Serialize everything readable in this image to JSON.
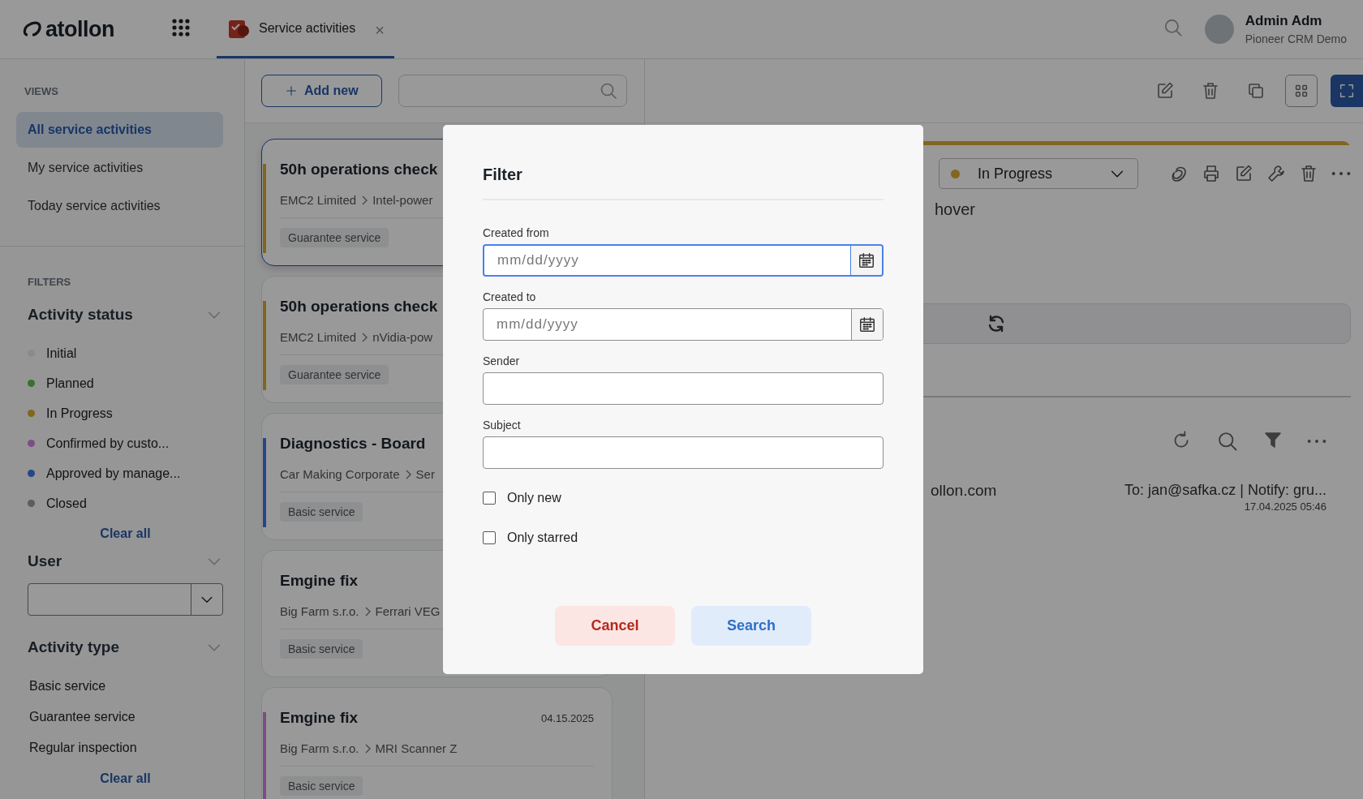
{
  "header": {
    "logo": "atollon",
    "tab": {
      "label": "Service activities",
      "close": "×"
    },
    "user": {
      "name": "Admin Adm",
      "org": "Pioneer CRM Demo"
    }
  },
  "sidebar": {
    "views_title": "VIEWS",
    "views": [
      {
        "label": "All service activities",
        "selected": true
      },
      {
        "label": "My service activities",
        "selected": false
      },
      {
        "label": "Today service activities",
        "selected": false
      }
    ],
    "filters_title": "FILTERS",
    "status_filter": {
      "title": "Activity status",
      "clear": "Clear all",
      "items": [
        {
          "label": "Initial",
          "color": "#8b8b8b"
        },
        {
          "label": "Planned",
          "color": "#37732c"
        },
        {
          "label": "In Progress",
          "color": "#82661f"
        },
        {
          "label": "Confirmed by custo...",
          "color": "#7d4c86"
        },
        {
          "label": "Approved by manage...",
          "color": "#244886"
        },
        {
          "label": "Closed",
          "color": "#5c5c5c"
        }
      ]
    },
    "user_filter": {
      "title": "User"
    },
    "type_filter": {
      "title": "Activity type",
      "clear": "Clear all",
      "items": [
        "Basic service",
        "Guarantee service",
        "Regular inspection"
      ]
    }
  },
  "list": {
    "add_button": "Add new",
    "cards": [
      {
        "title": "50h operations check",
        "customer": "EMC2 Limited",
        "asset": "Intel-power",
        "tag": "Guarantee service",
        "color": "#82661f",
        "selected": true
      },
      {
        "title": "50h operations check",
        "customer": "EMC2 Limited",
        "asset": "nVidia-pow",
        "tag": "Guarantee service",
        "color": "#82661f",
        "selected": false
      },
      {
        "title": "Diagnostics - Board",
        "customer": "Car Making Corporate",
        "asset": "Ser",
        "tag": "Basic service",
        "color": "#244886",
        "selected": false
      },
      {
        "title": "Emgine fix",
        "customer": "Big Farm s.r.o.",
        "asset": "Ferrari VEG",
        "tag": "Basic service",
        "selected": false
      },
      {
        "title": "Emgine fix",
        "customer": "Big Farm s.r.o.",
        "asset": "MRI Scanner Z",
        "tag": "Basic service",
        "color": "#7d4c86",
        "selected": false,
        "date": "04.15.2025"
      }
    ]
  },
  "detail": {
    "status": {
      "label": "In Progress",
      "color": "#82661f"
    },
    "text": "hover",
    "email": {
      "from": "ollon.com",
      "to": "To: jan@safka.cz | Notify: gru...",
      "time": "17.04.2025 05:46"
    }
  },
  "dialog": {
    "title": "Filter",
    "fields": [
      {
        "kind": "date",
        "label": "Created from",
        "placeholder": "mm/dd/yyyy",
        "focused": true
      },
      {
        "kind": "date",
        "label": "Created to",
        "placeholder": "mm/dd/yyyy",
        "focused": false
      },
      {
        "kind": "text",
        "label": "Sender",
        "focused": false
      },
      {
        "kind": "text",
        "label": "Subject",
        "focused": false
      }
    ],
    "checkboxes": [
      {
        "label": "Only new",
        "checked": false
      },
      {
        "label": "Only starred",
        "checked": false
      }
    ],
    "buttons": [
      {
        "kind": "cancel",
        "label": "Cancel"
      },
      {
        "kind": "primary",
        "label": "Search"
      }
    ]
  }
}
